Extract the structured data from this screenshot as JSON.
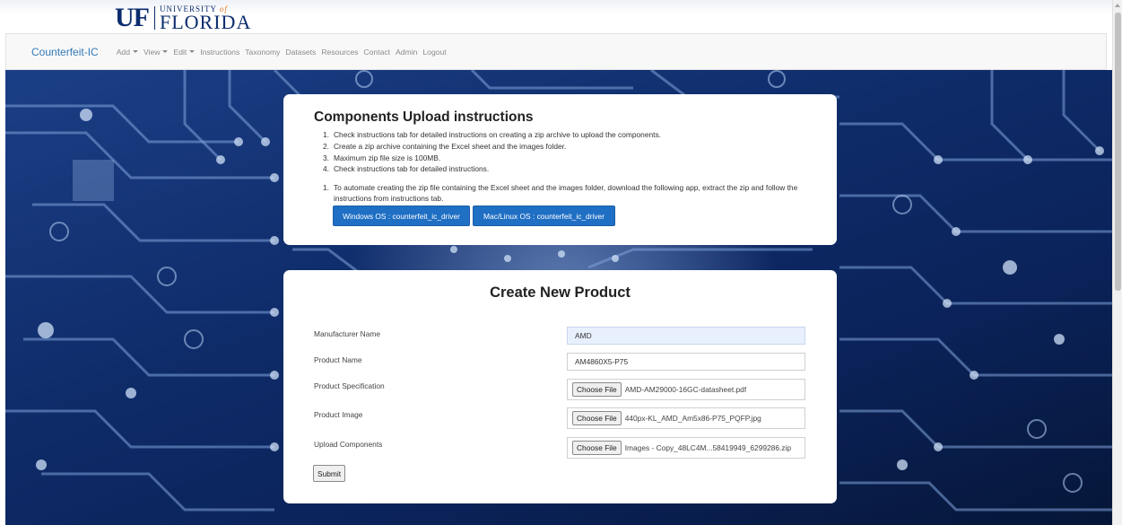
{
  "logo": {
    "mark": "UF",
    "univ": "UNIVERSITY",
    "of": "of",
    "florida": "FLORIDA"
  },
  "navbar": {
    "brand": "Counterfeit-IC",
    "items": [
      {
        "label": "Add",
        "dropdown": true
      },
      {
        "label": "View",
        "dropdown": true
      },
      {
        "label": "Edit",
        "dropdown": true
      },
      {
        "label": "Instructions",
        "dropdown": false
      },
      {
        "label": "Taxonomy",
        "dropdown": false
      },
      {
        "label": "Datasets",
        "dropdown": false
      },
      {
        "label": "Resources",
        "dropdown": false
      },
      {
        "label": "Contact",
        "dropdown": false
      },
      {
        "label": "Admin",
        "dropdown": false
      },
      {
        "label": "Logout",
        "dropdown": false
      }
    ]
  },
  "instructions": {
    "title": "Components Upload instructions",
    "steps": [
      {
        "num": "1.",
        "text": "Check instructions tab for detailed instructions on creating a zip archive to upload the components."
      },
      {
        "num": "2.",
        "text": "Create a zip archive containing the Excel sheet and the images folder."
      },
      {
        "num": "3.",
        "text": "Maximum zip file size is 100MB."
      },
      {
        "num": "4.",
        "text": "Check instructions tab for detailed instructions."
      }
    ],
    "automate": {
      "num": "1.",
      "text": "To automate creating the zip file containing the Excel sheet and the images folder, download the following app, extract the zip and follow the instructions from instructions tab."
    },
    "download_windows": "Windows OS : counterfeit_ic_driver",
    "download_mac": "Mac/Linux OS : counterfeit_ic_driver"
  },
  "form": {
    "title": "Create New Product",
    "choose_file_label": "Choose File",
    "fields": {
      "manufacturer": {
        "label": "Manufacturer Name",
        "value": "AMD"
      },
      "product_name": {
        "label": "Product Name",
        "value": "AM4860X5-P75"
      },
      "specification": {
        "label": "Product Specification",
        "file": "AMD-AM29000-16GC-datasheet.pdf"
      },
      "image": {
        "label": "Product Image",
        "file": "440px-KL_AMD_Am5x86-P75_PQFP.jpg"
      },
      "components": {
        "label": "Upload Components",
        "file": "Images - Copy_48LC4M...58419949_6299286.zip"
      }
    },
    "submit_label": "Submit"
  },
  "colors": {
    "brand_link": "#337ab7",
    "button_blue": "#1f6fc4",
    "uf_blue": "#0b2d6e",
    "uf_orange": "#e87722",
    "autofill_bg": "#e8f0fe"
  }
}
